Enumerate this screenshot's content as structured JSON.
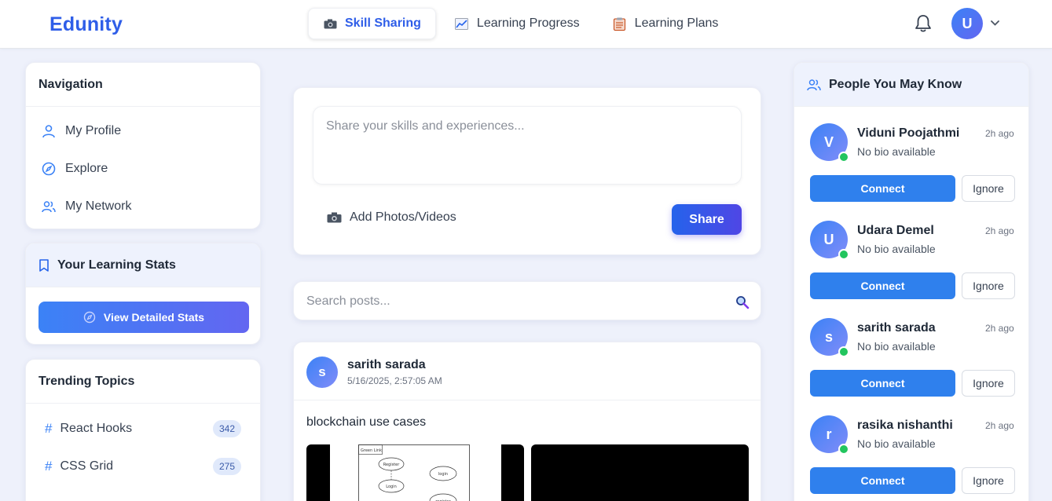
{
  "app": {
    "logo": "Edunity"
  },
  "topnav": {
    "tabs": [
      {
        "label": "Skill Sharing",
        "icon": "camera-icon",
        "active": true
      },
      {
        "label": "Learning Progress",
        "icon": "chart-icon",
        "active": false
      },
      {
        "label": "Learning Plans",
        "icon": "clipboard-icon",
        "active": false
      }
    ],
    "avatar_initial": "U"
  },
  "sidebar": {
    "navigation": {
      "title": "Navigation",
      "items": [
        {
          "label": "My Profile",
          "icon": "user-icon"
        },
        {
          "label": "Explore",
          "icon": "compass-icon"
        },
        {
          "label": "My Network",
          "icon": "users-icon"
        }
      ]
    },
    "stats": {
      "title": "Your Learning Stats",
      "button": "View Detailed Stats"
    },
    "trending": {
      "title": "Trending Topics",
      "items": [
        {
          "label": "React Hooks",
          "count": "342"
        },
        {
          "label": "CSS Grid",
          "count": "275"
        }
      ]
    }
  },
  "composer": {
    "placeholder": "Share your skills and experiences...",
    "add_media": "Add Photos/Videos",
    "share": "Share"
  },
  "search": {
    "placeholder": "Search posts..."
  },
  "post": {
    "author": "sarith sarada",
    "initial": "s",
    "timestamp": "5/16/2025, 2:57:05 AM",
    "text": "blockchain use cases",
    "diagram": {
      "header": "Green Link",
      "ovals": [
        "Register",
        "Login",
        "login",
        "register"
      ]
    }
  },
  "people": {
    "title": "People You May Know",
    "connect_label": "Connect",
    "ignore_label": "Ignore",
    "items": [
      {
        "name": "Viduni Poojathmi",
        "initial": "V",
        "bio": "No bio available",
        "time": "2h ago"
      },
      {
        "name": "Udara Demel",
        "initial": "U",
        "bio": "No bio available",
        "time": "2h ago"
      },
      {
        "name": "sarith sarada",
        "initial": "s",
        "bio": "No bio available",
        "time": "2h ago"
      },
      {
        "name": "rasika nishanthi",
        "initial": "r",
        "bio": "No bio available",
        "time": "2h ago"
      }
    ]
  },
  "colors": {
    "accent": "#2f5ee8",
    "connect": "#2f80ed",
    "online": "#22c55e"
  }
}
